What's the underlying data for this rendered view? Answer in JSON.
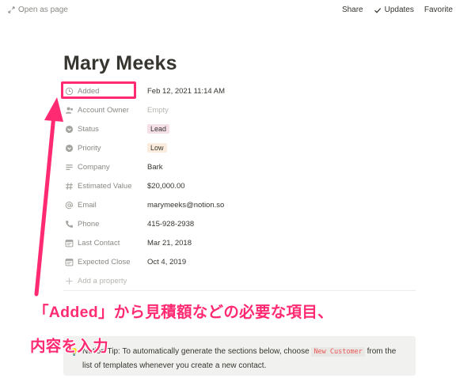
{
  "topbar": {
    "open_as_page": "Open as page",
    "share": "Share",
    "updates": "Updates",
    "favorite": "Favorite"
  },
  "page": {
    "title": "Mary Meeks"
  },
  "properties": [
    {
      "name": "Added",
      "icon": "clock-icon",
      "value": "Feb 12, 2021 11:14 AM"
    },
    {
      "name": "Account Owner",
      "icon": "person-icon",
      "value": "Empty"
    },
    {
      "name": "Status",
      "icon": "select-icon",
      "value": "Lead",
      "tag_color": "#f5e0e9"
    },
    {
      "name": "Priority",
      "icon": "select-icon",
      "value": "Low",
      "tag_color": "#fbecdd"
    },
    {
      "name": "Company",
      "icon": "text-lines-icon",
      "value": "Bark"
    },
    {
      "name": "Estimated Value",
      "icon": "hash-icon",
      "value": "$20,000.00"
    },
    {
      "name": "Email",
      "icon": "at-icon",
      "value": "marymeeks@notion.so"
    },
    {
      "name": "Phone",
      "icon": "phone-icon",
      "value": "415-928-2938"
    },
    {
      "name": "Last Contact",
      "icon": "calendar-icon",
      "value": "Mar 21, 2018"
    },
    {
      "name": "Expected Close",
      "icon": "calendar-icon",
      "value": "Oct 4, 2019"
    }
  ],
  "add_property": "Add a property",
  "annotation": {
    "line1": "「Added」から見積額などの必要な項目、",
    "line2": "内容を入力",
    "color": "#ff2a72"
  },
  "tip": {
    "emoji": "💡",
    "text_before": "Notion Tip: To automatically generate the sections below, choose",
    "code": "New Customer",
    "text_after": "from the list of templates whenever you create a new contact."
  }
}
